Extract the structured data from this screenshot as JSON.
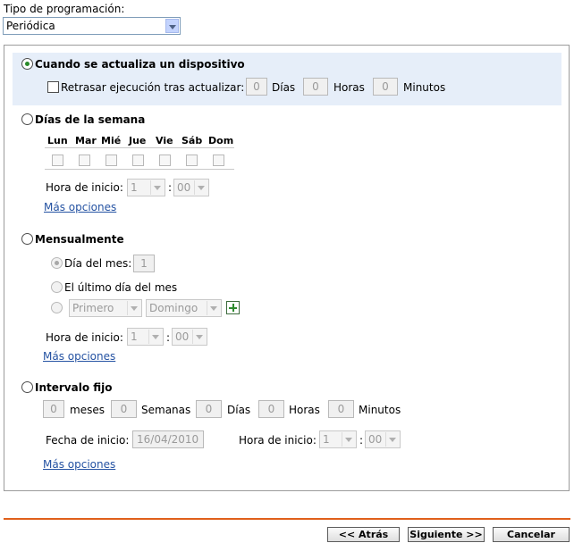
{
  "schedule_type": {
    "label": "Tipo de programación:",
    "value": "Periódica"
  },
  "on_update": {
    "label": "Cuando se actualiza un dispositivo",
    "delay_label": "Retrasar ejecución tras actualizar:",
    "days_value": "0",
    "days_label": "Días",
    "hours_value": "0",
    "hours_label": "Horas",
    "minutes_value": "0",
    "minutes_label": "Minutos"
  },
  "weekdays": {
    "label": "Días de la semana",
    "days": [
      "Lun",
      "Mar",
      "Mié",
      "Jue",
      "Vie",
      "Sáb",
      "Dom"
    ],
    "start_label": "Hora de inicio:",
    "hour_value": "1",
    "minute_value": "00",
    "separator": ":",
    "more_options": "Más opciones"
  },
  "monthly": {
    "label": "Mensualmente",
    "day_of_month_label": "Día del mes:",
    "day_of_month_value": "1",
    "last_day_label": "El último día del mes",
    "ordinal_value": "Primero",
    "weekday_value": "Domingo",
    "start_label": "Hora de inicio:",
    "hour_value": "1",
    "minute_value": "00",
    "separator": ":",
    "more_options": "Más opciones"
  },
  "fixed_interval": {
    "label": "Intervalo fijo",
    "months_value": "0",
    "months_label": "meses",
    "weeks_value": "0",
    "weeks_label": "Semanas",
    "days_value": "0",
    "days_label": "Días",
    "hours_value": "0",
    "hours_label": "Horas",
    "minutes_value": "0",
    "minutes_label": "Minutos",
    "start_date_label": "Fecha de inicio:",
    "start_date_value": "16/04/2010",
    "start_time_label": "Hora de inicio:",
    "hour_value": "1",
    "minute_value": "00",
    "separator": ":",
    "more_options": "Más opciones"
  },
  "footer": {
    "back": "<< Atrás",
    "next": "Siguiente >>",
    "cancel": "Cancelar"
  },
  "colors": {
    "accent_line": "#e0601b",
    "link": "#2452a2",
    "highlight": "#e6eef9"
  }
}
